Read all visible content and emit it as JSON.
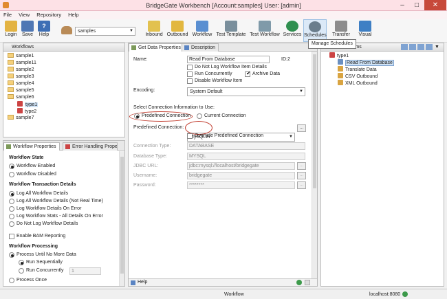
{
  "window": {
    "title": "BridgeGate Workbench [Account:samples] User: [admin]"
  },
  "menu": [
    "File",
    "View",
    "Repository",
    "Help"
  ],
  "toolbar": {
    "login": "Login",
    "save": "Save",
    "help": "Help",
    "account_select": "samples",
    "buttons": [
      "Inbound",
      "Outbound",
      "Workflow",
      "Test Template",
      "Test Workflow",
      "Services",
      "Schedules",
      "Transfer",
      "Visual"
    ],
    "tooltip": "Manage Schedules"
  },
  "workflows_panel": {
    "title": "Workflows",
    "items": [
      "sample1",
      "sample11",
      "sample2",
      "sample3",
      "sample4",
      "sample5",
      "sample6",
      "type1",
      "type2",
      "sample7"
    ]
  },
  "props_tabs": [
    "Workflow Properties",
    "Error Handling Prope"
  ],
  "workflow_props": {
    "state_title": "Workflow State",
    "enabled": "Workflow Enabled",
    "disabled": "Workflow Disabled",
    "transaction_title": "Workflow Transaction Details",
    "log_all": "Log All Workflow Details",
    "log_all_not_real_time": "Log All Workflow Details (Not Real Time)",
    "log_on_error": "Log Workflow Details On Error",
    "log_stats": "Log Workflow Stats - All Details On Error",
    "no_log": "Do Not Log Workflow Details",
    "bam": "Enable BAM Reporting",
    "processing_title": "Workflow Processing",
    "until_no_more": "Process Until No More Data",
    "sequential": "Run Sequentially",
    "concurrently": "Run Concurrently",
    "concurrent_value": "1",
    "once": "Process Once"
  },
  "center_tabs": [
    "Get Data Properties",
    "Description"
  ],
  "get_data": {
    "name_label": "Name:",
    "name_value": "Read From Database",
    "id": "ID:2",
    "no_log": "Do Not Log Workflow Item Details",
    "run_concurrently": "Run Concurrently",
    "archive": "Archive Data",
    "disable": "Disable Workflow Item",
    "encoding_label": "Encoding:",
    "encoding_value": "System Default",
    "select_conn": "Select Connection Information to Use:",
    "predefined": "Predefined Connection",
    "current": "Current Connection",
    "predefined_label": "Predefined Connection:",
    "predefined_value": "MySQLIn",
    "override": "Override Predefined Connection",
    "conn_type_label": "Connection Type:",
    "conn_type_value": "DATABASE",
    "db_type_label": "Database Type:",
    "db_type_value": "MYSQL",
    "jdbc_label": "JDBC URL:",
    "jdbc_value": "jdbc:mysql://localhost/bridgegate",
    "user_label": "Username:",
    "user_value": "bridgegate",
    "pass_label": "Password:",
    "pass_value": "********",
    "button": "..."
  },
  "help_label": "Help",
  "right_panel": {
    "title": "items",
    "root": "type1",
    "items": [
      "Read From Database",
      "Translate Data",
      "CSV Outbound",
      "XML Outbound"
    ]
  },
  "status": {
    "center": "Workflow",
    "server": "localhost:8080"
  }
}
